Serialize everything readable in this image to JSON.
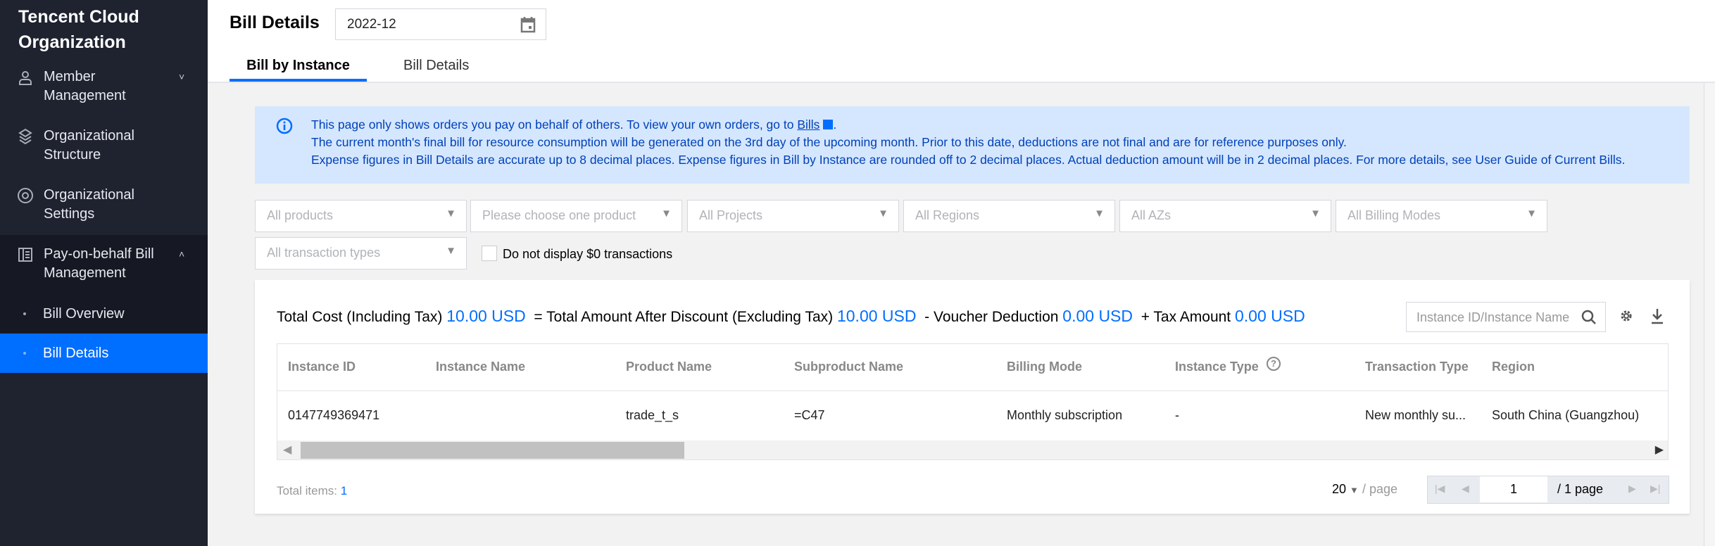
{
  "sidebar": {
    "title": "Tencent Cloud Organization",
    "items": [
      {
        "label": "Member Management",
        "icon": "user-icon",
        "chevron": "˅"
      },
      {
        "label": "Organizational Structure",
        "icon": "structure-icon"
      },
      {
        "label": "Organizational Settings",
        "icon": "settings-icon"
      },
      {
        "label": "Pay-on-behalf Bill Management",
        "icon": "bill-icon",
        "chevron": "˄"
      }
    ],
    "subitems": [
      {
        "label": "Bill Overview"
      },
      {
        "label": "Bill Details",
        "active": true
      }
    ]
  },
  "header": {
    "title": "Bill Details",
    "date": "2022-12",
    "tabs": [
      {
        "label": "Bill by Instance",
        "active": true
      },
      {
        "label": "Bill Details"
      }
    ]
  },
  "notice": {
    "line1_pre": "This page only shows orders you pay on behalf of others. To view your own orders, go to ",
    "line1_link": "Bills",
    "line1_post": ".",
    "line2": "The current month's final bill for resource consumption will be generated on the 3rd day of the upcoming month. Prior to this date, deductions are not final and are for reference purposes only.",
    "line3": "Expense figures in Bill Details are accurate up to 8 decimal places. Expense figures in Bill by Instance are rounded off to 2 decimal places. Actual deduction amount will be in 2 decimal places. For more details, see User Guide of Current Bills."
  },
  "filters": [
    "All products",
    "Please choose one product",
    "All Projects",
    "All Regions",
    "All AZs",
    "All Billing Modes",
    "All transaction types"
  ],
  "zero_checkbox": {
    "label": "Do not display $0 transactions",
    "checked": false
  },
  "summary": {
    "total_label": "Total Cost (Including Tax)",
    "total": "10.00 USD",
    "after_label": "= Total Amount After Discount (Excluding Tax)",
    "after": "10.00 USD",
    "voucher_label": "- Voucher Deduction",
    "voucher": "0.00 USD",
    "tax_label": "+ Tax Amount",
    "tax": "0.00 USD"
  },
  "search": {
    "placeholder": "Instance ID/Instance Name"
  },
  "table": {
    "columns": [
      "Instance ID",
      "Instance Name",
      "Product Name",
      "Subproduct Name",
      "Billing Mode",
      "Instance Type",
      "Transaction Type",
      "Region"
    ],
    "rows": [
      [
        "0147749369471",
        "",
        "trade_t_s",
        "=C47",
        "Monthly subscription",
        "-",
        "New monthly su...",
        "South China (Guangzhou)"
      ]
    ]
  },
  "footer": {
    "total_label": "Total items:",
    "total": "1",
    "page_size": "20",
    "per_page": "/ page",
    "page": "1",
    "page_total": "/ 1 page"
  },
  "colors": {
    "accent": "#006eff",
    "sidebar": "#1f2330",
    "notice_bg": "#d5e7ff"
  }
}
